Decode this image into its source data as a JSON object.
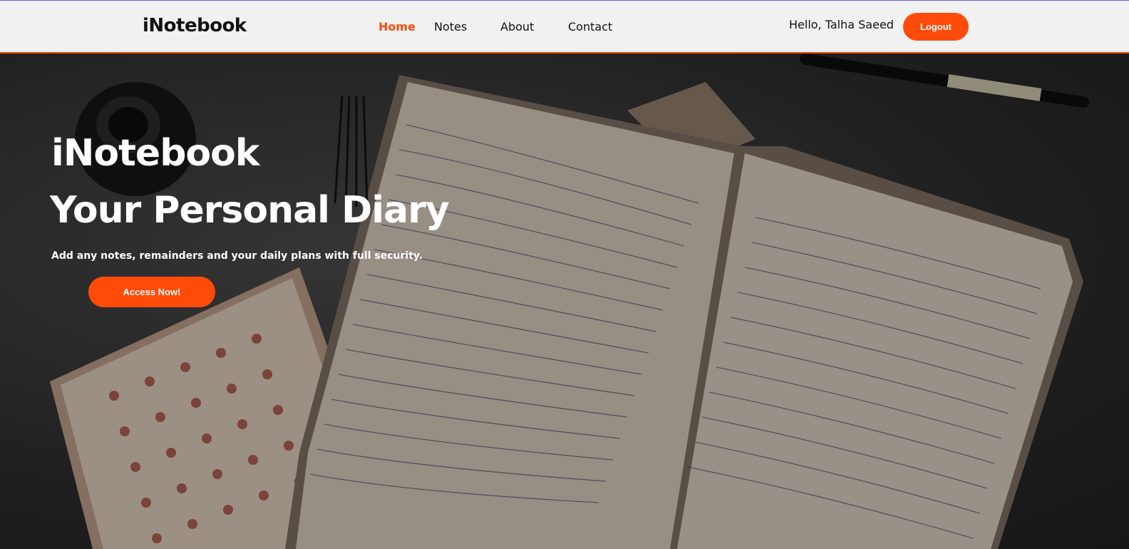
{
  "navbar": {
    "brand": "iNotebook",
    "links": [
      {
        "label": "Home",
        "active": true
      },
      {
        "label": "Notes",
        "active": false
      },
      {
        "label": "About",
        "active": false
      },
      {
        "label": "Contact",
        "active": false
      }
    ],
    "greeting": "Hello, Talha Saeed",
    "logout_label": "Logout"
  },
  "hero": {
    "title": "iNotebook",
    "subtitle": "Your Personal Diary",
    "description": "Add any notes, remainders and your daily plans with full security.",
    "cta_label": "Access Now!"
  },
  "colors": {
    "accent": "#ff4b0a",
    "navbar_bg": "#f1f1f1",
    "text_dark": "#111111",
    "text_light": "#ffffff"
  }
}
